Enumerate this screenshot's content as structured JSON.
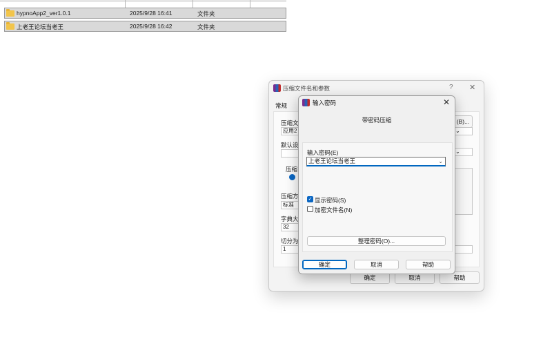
{
  "file_list": {
    "rows": [
      {
        "name": "hypnoApp2_ver1.0.1",
        "date": "2025/9/28 16:41",
        "type": "文件夹"
      },
      {
        "name": "上老王论坛当老王",
        "date": "2025/9/28 16:42",
        "type": "文件夹"
      }
    ]
  },
  "archive_dialog": {
    "title": "压缩文件名和参数",
    "help": "?",
    "close": "✕",
    "tab_general": "常规",
    "label_archive_name": "压缩文",
    "archive_name_value": "应用2",
    "browse_button": "(B)...",
    "label_default": "默认设",
    "label_format": "压缩",
    "label_method": "压缩方",
    "method_value": "标准",
    "label_dict": "字典大",
    "dict_value": "32",
    "label_split": "切分为",
    "split_value": "1",
    "ok": "确定",
    "cancel": "取消",
    "help_button": "帮助"
  },
  "password_dialog": {
    "title": "输入密码",
    "close": "✕",
    "heading": "带密码压缩",
    "label_password": "输入密码(E)",
    "password_value": "上老王论坛当老王",
    "show_password": "显示密码(S)",
    "show_password_checked": true,
    "encrypt_names": "加密文件名(N)",
    "encrypt_names_checked": false,
    "organize_button": "整理密码(O)...",
    "ok": "确定",
    "cancel": "取消",
    "help": "帮助"
  }
}
